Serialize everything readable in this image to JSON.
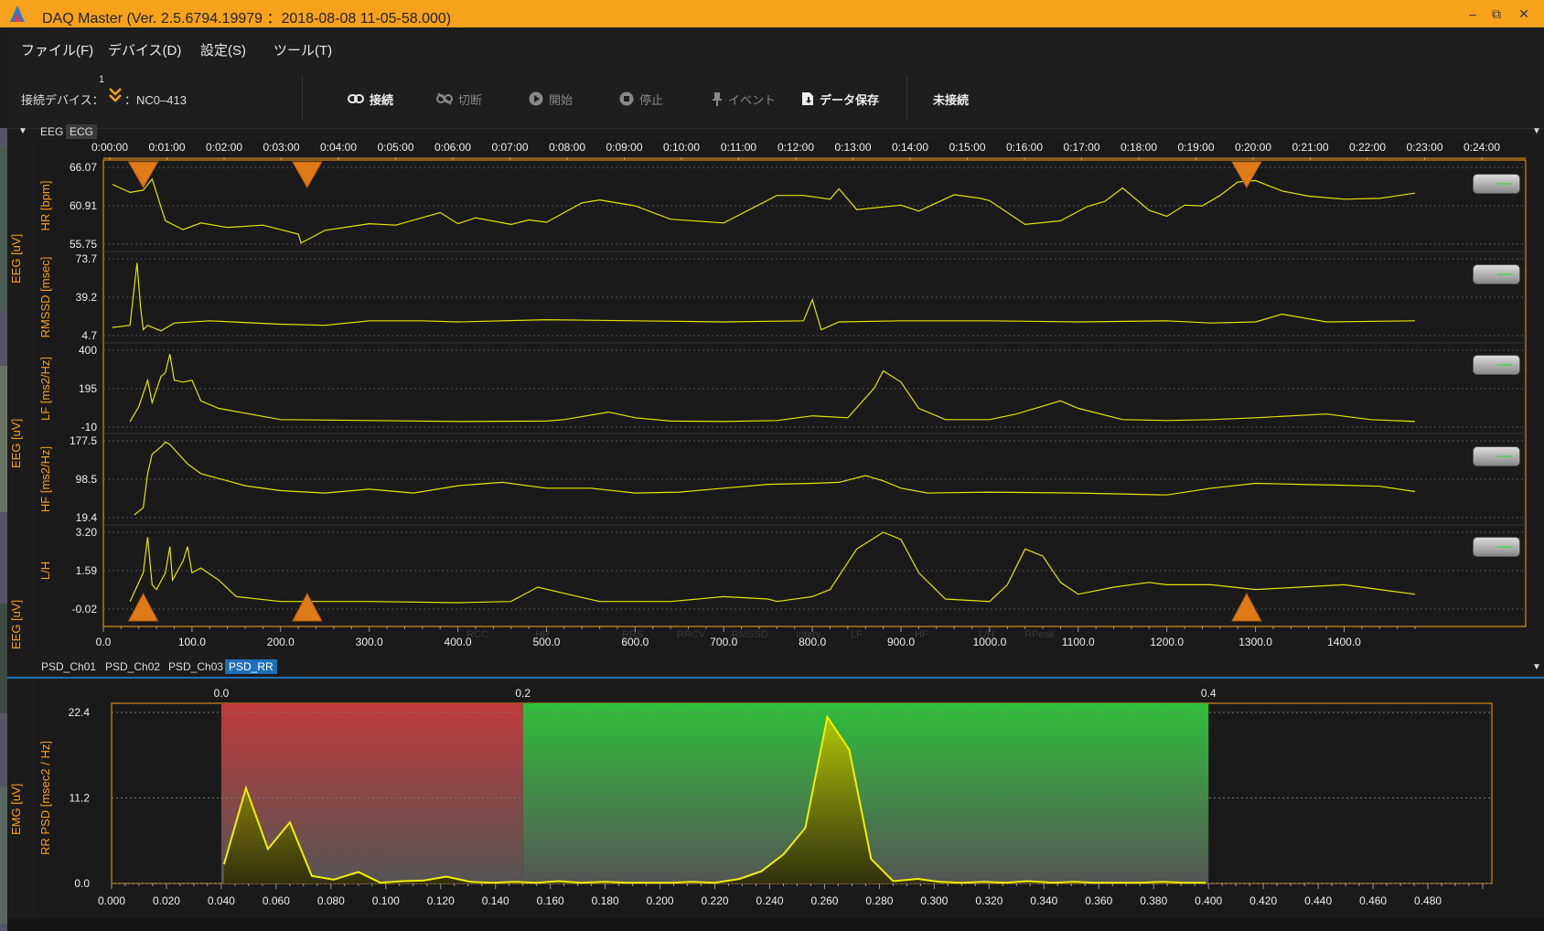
{
  "window": {
    "title": "DAQ Master (Ver. 2.5.6794.19979 ：2018-08-08 11-05-58.000)",
    "buttons": {
      "minimize": "–",
      "restore": "⧉",
      "close": "✕"
    }
  },
  "menu": {
    "file": "ファイル(F)",
    "device": "デバイス(D)",
    "settings": "設定(S)",
    "tools": "ツール(T)"
  },
  "toolbar": {
    "device_label": "接続デバイス：",
    "device_count": "1",
    "device_name": "：NC0–413",
    "connect": "接続",
    "disconnect": "切断",
    "start": "開始",
    "stop": "停止",
    "event": "イベント",
    "save": "データ保存",
    "status": "未接続"
  },
  "colors": {
    "accent": "#f7a21b",
    "trace": "#e5e500",
    "lf_band": "#c03a3a",
    "hf_band": "#2fbf3a"
  },
  "signal_tabs": [
    "EEG",
    "ECG"
  ],
  "psd_tabs": [
    "PSD_Ch01",
    "PSD_Ch02",
    "PSD_Ch03",
    "PSD_RR"
  ],
  "side_labels": {
    "a": "EEG [uV]",
    "b": "EEG [uV]",
    "c": "EEG [uV]",
    "d": "EMG [uV]"
  },
  "time_axis": [
    "0:00:00",
    "0:01:00",
    "0:02:00",
    "0:03:00",
    "0:04:00",
    "0:05:00",
    "0:06:00",
    "0:07:00",
    "0:08:00",
    "0:09:00",
    "0:10:00",
    "0:11:00",
    "0:12:00",
    "0:13:00",
    "0:14:00",
    "0:15:00",
    "0:16:00",
    "0:17:00",
    "0:18:00",
    "0:19:00",
    "0:20:00",
    "0:21:00",
    "0:22:00",
    "0:23:00",
    "0:24:00"
  ],
  "x_axis": {
    "ticks": [
      0.0,
      100.0,
      200.0,
      300.0,
      400.0,
      500.0,
      600.0,
      700.0,
      800.0,
      900.0,
      1000.0,
      1100.0,
      1200.0,
      1300.0,
      1400.0
    ],
    "range": [
      0,
      1480
    ]
  },
  "legend_faint": [
    "RCC",
    "HR",
    "RRS",
    "RRCV",
    "RMSSD",
    "Interv",
    "LF",
    "HF",
    "L/H",
    "RPeak"
  ],
  "chart_data": [
    {
      "type": "line",
      "ylabel": "HR [bpm]",
      "yticks": [
        "66.07",
        "60.91",
        "55.75"
      ],
      "ylim": [
        55.75,
        66.07
      ],
      "x": [
        10,
        30,
        45,
        55,
        70,
        90,
        110,
        140,
        180,
        220,
        223,
        250,
        300,
        330,
        380,
        400,
        420,
        460,
        480,
        500,
        540,
        560,
        600,
        640,
        700,
        760,
        790,
        820,
        830,
        850,
        900,
        920,
        960,
        990,
        1000,
        1040,
        1080,
        1110,
        1130,
        1150,
        1180,
        1200,
        1220,
        1240,
        1260,
        1280,
        1300,
        1330,
        1360,
        1400,
        1440,
        1480
      ],
      "values": [
        63.8,
        62.7,
        63.0,
        64.5,
        58.9,
        57.7,
        58.6,
        58.0,
        58.3,
        57.1,
        55.9,
        57.6,
        58.5,
        58.3,
        60.0,
        58.5,
        59.3,
        58.4,
        59.0,
        58.7,
        61.3,
        61.7,
        60.9,
        59.1,
        58.6,
        62.3,
        62.3,
        61.8,
        63.2,
        60.4,
        61.0,
        60.2,
        62.4,
        61.9,
        61.6,
        58.4,
        58.9,
        60.8,
        61.5,
        63.3,
        60.3,
        59.5,
        61.0,
        60.9,
        62.3,
        64.1,
        64.3,
        62.9,
        62.2,
        61.8,
        61.9,
        62.6
      ]
    },
    {
      "type": "line",
      "ylabel": "RMSSD [msec]",
      "yticks": [
        "73.7",
        "39.2",
        "4.7"
      ],
      "ylim": [
        4.7,
        73.7
      ],
      "x": [
        10,
        30,
        38,
        42,
        45,
        50,
        65,
        80,
        120,
        200,
        250,
        300,
        360,
        400,
        500,
        600,
        700,
        790,
        800,
        810,
        830,
        900,
        1000,
        1100,
        1200,
        1250,
        1300,
        1330,
        1380,
        1480
      ],
      "values": [
        12,
        14,
        70,
        30,
        10,
        14,
        9,
        16,
        18,
        15,
        14,
        18,
        18,
        17,
        19,
        18,
        17,
        18,
        37,
        10,
        17,
        18,
        18,
        17,
        18,
        16,
        17,
        24,
        17,
        18
      ]
    },
    {
      "type": "line",
      "ylabel": "LF [ms2/Hz]",
      "yticks": [
        "400",
        "195",
        "-10"
      ],
      "ylim": [
        -10,
        400
      ],
      "x": [
        30,
        40,
        50,
        55,
        65,
        70,
        75,
        80,
        90,
        100,
        110,
        130,
        200,
        300,
        400,
        500,
        520,
        570,
        600,
        640,
        700,
        760,
        800,
        840,
        870,
        880,
        900,
        920,
        950,
        1000,
        1030,
        1080,
        1100,
        1150,
        1200,
        1250,
        1300,
        1380,
        1430,
        1480
      ],
      "values": [
        20,
        100,
        240,
        120,
        260,
        280,
        380,
        240,
        230,
        240,
        130,
        90,
        30,
        25,
        20,
        22,
        30,
        70,
        40,
        22,
        20,
        25,
        50,
        40,
        200,
        290,
        230,
        90,
        30,
        30,
        60,
        130,
        90,
        30,
        25,
        30,
        40,
        60,
        30,
        20
      ]
    },
    {
      "type": "line",
      "ylabel": "HF [ms2/Hz]",
      "yticks": [
        "177.5",
        "98.5",
        "19.4"
      ],
      "ylim": [
        19.4,
        177.5
      ],
      "x": [
        35,
        45,
        50,
        55,
        65,
        70,
        75,
        85,
        95,
        110,
        130,
        160,
        200,
        250,
        300,
        350,
        400,
        450,
        500,
        550,
        600,
        650,
        700,
        750,
        800,
        830,
        860,
        880,
        900,
        930,
        1000,
        1100,
        1200,
        1250,
        1300,
        1350,
        1400,
        1440,
        1480
      ],
      "values": [
        25,
        40,
        110,
        150,
        165,
        175,
        170,
        150,
        130,
        110,
        100,
        85,
        75,
        70,
        78,
        70,
        85,
        92,
        80,
        80,
        70,
        72,
        80,
        88,
        90,
        92,
        106,
        95,
        80,
        70,
        72,
        70,
        66,
        80,
        90,
        88,
        86,
        84,
        73
      ]
    },
    {
      "type": "line",
      "ylabel": "L/H",
      "yticks": [
        "3.20",
        "1.59",
        "-0.02"
      ],
      "ylim": [
        -0.02,
        3.2
      ],
      "x": [
        30,
        45,
        50,
        55,
        60,
        70,
        75,
        78,
        90,
        95,
        100,
        110,
        130,
        150,
        200,
        300,
        400,
        460,
        490,
        530,
        560,
        640,
        700,
        750,
        760,
        800,
        820,
        850,
        880,
        900,
        920,
        950,
        1000,
        1020,
        1040,
        1060,
        1080,
        1100,
        1140,
        1180,
        1200,
        1250,
        1300,
        1350,
        1400,
        1440,
        1480
      ],
      "values": [
        0.3,
        1.5,
        3.0,
        1.0,
        0.8,
        1.5,
        2.6,
        1.2,
        2.0,
        2.6,
        1.5,
        1.7,
        1.2,
        0.5,
        0.3,
        0.3,
        0.25,
        0.3,
        0.9,
        0.55,
        0.3,
        0.3,
        0.5,
        0.4,
        0.3,
        0.5,
        0.8,
        2.5,
        3.2,
        2.9,
        1.5,
        0.4,
        0.3,
        1.0,
        2.5,
        2.2,
        1.1,
        0.6,
        0.9,
        1.1,
        1.0,
        1.0,
        0.8,
        0.9,
        1.0,
        0.8,
        0.6
      ]
    },
    {
      "type": "area",
      "ylabel": "RR PSD [msec2 / Hz]",
      "xlabel": "",
      "yticks": [
        "22.4",
        "11.2",
        "0.0"
      ],
      "ylim": [
        0,
        22.4
      ],
      "xticks": [
        "0.000",
        "0.020",
        "0.040",
        "0.060",
        "0.080",
        "0.100",
        "0.120",
        "0.140",
        "0.160",
        "0.180",
        "0.200",
        "0.220",
        "0.240",
        "0.260",
        "0.280",
        "0.300",
        "0.320",
        "0.340",
        "0.360",
        "0.380",
        "0.400",
        "0.420",
        "0.440",
        "0.460",
        "0.480"
      ],
      "xlim": [
        0,
        0.5
      ],
      "band_labels": [
        "0.0",
        "0.2",
        "0.4"
      ],
      "bands": [
        {
          "from": 0.04,
          "to": 0.15,
          "color": "lf"
        },
        {
          "from": 0.15,
          "to": 0.4,
          "color": "hf"
        }
      ],
      "x": [
        0.041,
        0.049,
        0.057,
        0.065,
        0.073,
        0.081,
        0.09,
        0.098,
        0.106,
        0.114,
        0.122,
        0.131,
        0.139,
        0.147,
        0.155,
        0.163,
        0.171,
        0.18,
        0.188,
        0.196,
        0.204,
        0.212,
        0.22,
        0.229,
        0.237,
        0.245,
        0.253,
        0.261,
        0.269,
        0.277,
        0.285,
        0.294,
        0.302,
        0.31,
        0.318,
        0.326,
        0.334,
        0.343,
        0.351,
        0.359,
        0.367,
        0.375,
        0.383,
        0.391,
        0.399
      ],
      "values": [
        2.5,
        12.5,
        4.5,
        8.0,
        1.0,
        0.5,
        1.5,
        0.1,
        0.3,
        0.4,
        0.9,
        0.2,
        0.1,
        0.2,
        0.1,
        0.3,
        0.1,
        0.2,
        0.1,
        0.1,
        0.1,
        0.2,
        0.1,
        0.6,
        1.6,
        3.8,
        7.3,
        21.8,
        17.5,
        3.2,
        0.3,
        0.6,
        0.2,
        0.1,
        0.2,
        0.1,
        0.3,
        0.1,
        0.2,
        0.1,
        0.1,
        0.1,
        0.2,
        0.1,
        0.1
      ]
    }
  ]
}
